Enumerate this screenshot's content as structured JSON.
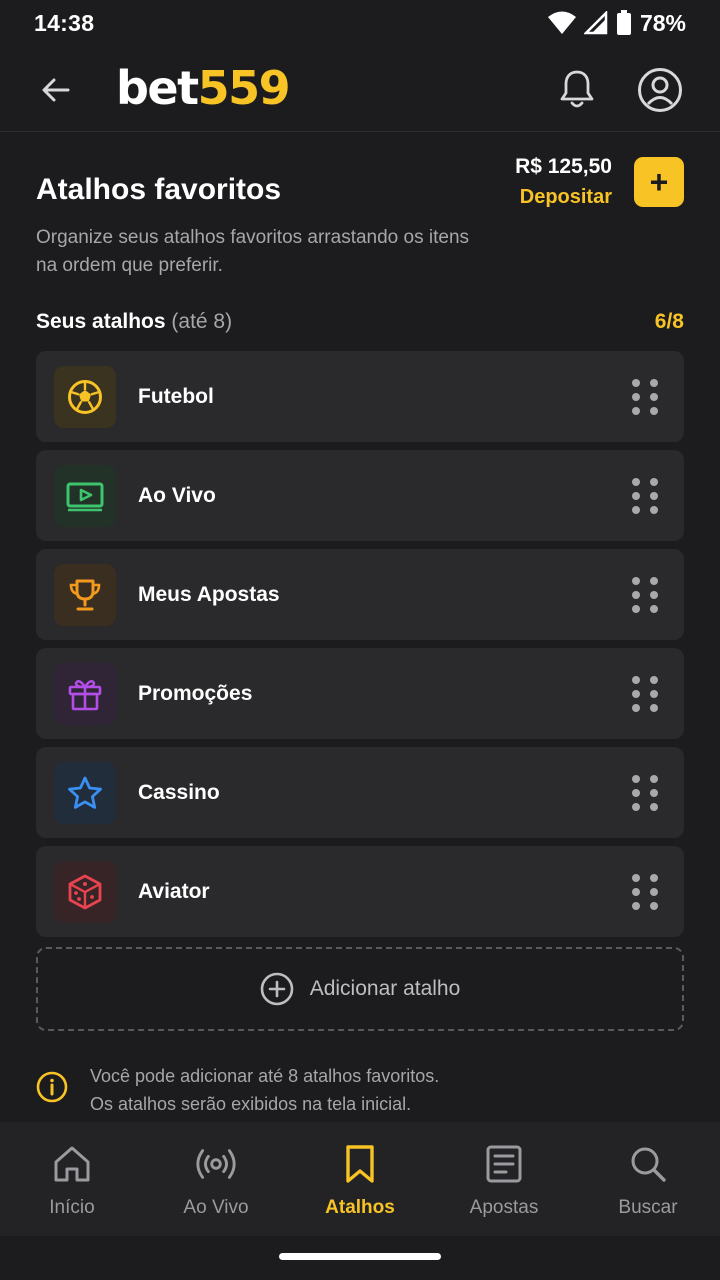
{
  "status_bar": {
    "time": "14:38",
    "battery": "78%"
  },
  "header": {
    "logo_part1": "bet",
    "logo_part2": "559"
  },
  "balance": {
    "amount": "R$ 125,50",
    "deposit_label": "Depositar",
    "add_label": "+"
  },
  "page": {
    "title": "Atalhos favoritos",
    "description": "Organize seus atalhos favoritos arrastando os itens na ordem que preferir."
  },
  "section": {
    "title": "Seus atalhos",
    "limit": "(até 8)",
    "count": "6/8"
  },
  "shortcuts": [
    {
      "label": "Futebol",
      "icon": "soccer-ball-icon",
      "color": "#f7c325"
    },
    {
      "label": "Ao Vivo",
      "icon": "play-screen-icon",
      "color": "#3ec46d"
    },
    {
      "label": "Meus Apostas",
      "icon": "trophy-icon",
      "color": "#f39a1e"
    },
    {
      "label": "Promoções",
      "icon": "gift-icon",
      "color": "#b34ee9"
    },
    {
      "label": "Cassino",
      "icon": "star-icon",
      "color": "#3a8ff2"
    },
    {
      "label": "Aviator",
      "icon": "dice-icon",
      "color": "#e8434f"
    }
  ],
  "add_shortcut": {
    "label": "Adicionar atalho"
  },
  "info": {
    "line1": "Você pode adicionar até 8 atalhos favoritos.",
    "line2": "Os atalhos serão exibidos na tela inicial."
  },
  "bottom_nav": [
    {
      "label": "Início",
      "icon": "home-icon",
      "active": false
    },
    {
      "label": "Ao Vivo",
      "icon": "live-broadcast-icon",
      "active": false
    },
    {
      "label": "Atalhos",
      "icon": "bookmark-icon",
      "active": true
    },
    {
      "label": "Apostas",
      "icon": "betslip-icon",
      "active": false
    },
    {
      "label": "Buscar",
      "icon": "search-icon",
      "active": false
    }
  ],
  "colors": {
    "accent": "#f7c325",
    "background": "#1c1c1e",
    "card": "#2a2a2d"
  }
}
